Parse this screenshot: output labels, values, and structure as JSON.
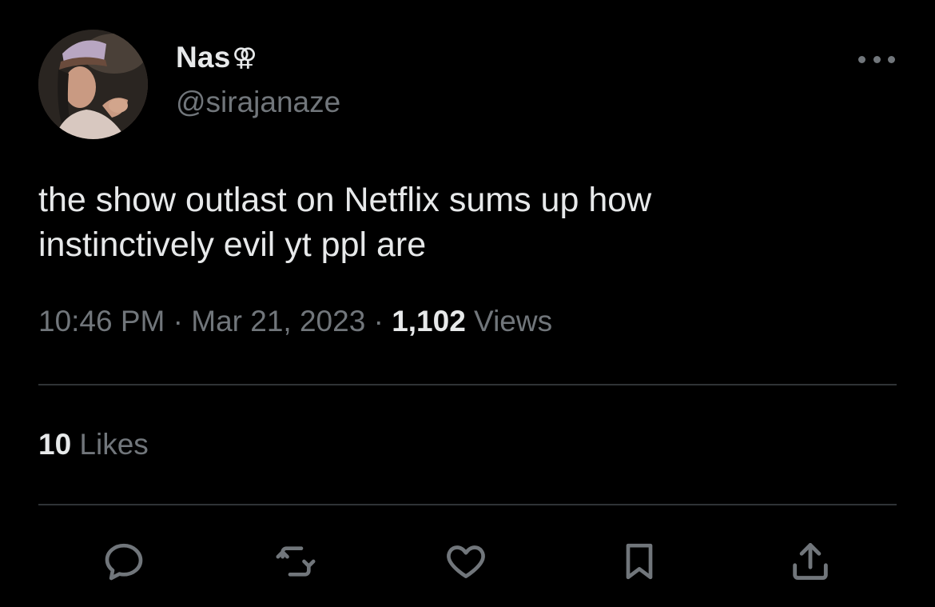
{
  "tweet": {
    "display_name": "Nas",
    "name_emoji": "⚢",
    "handle": "@sirajanaze",
    "text_line1": "the show outlast on Netflix sums up how",
    "text_line2": "instinctively evil yt ppl are",
    "time": "10:46 PM",
    "separator": " · ",
    "date": "Mar 21, 2023",
    "views_count": "1,102",
    "views_label": " Views",
    "likes_count": "10",
    "likes_label": " Likes"
  },
  "icons": {
    "more": "more-horizontal-icon",
    "reply": "reply-icon",
    "retweet": "retweet-icon",
    "like": "heart-icon",
    "bookmark": "bookmark-icon",
    "share": "share-icon"
  },
  "colors": {
    "background": "#000000",
    "primary_text": "#e7e9ea",
    "secondary_text": "#71767b",
    "divider": "#2f3336"
  }
}
